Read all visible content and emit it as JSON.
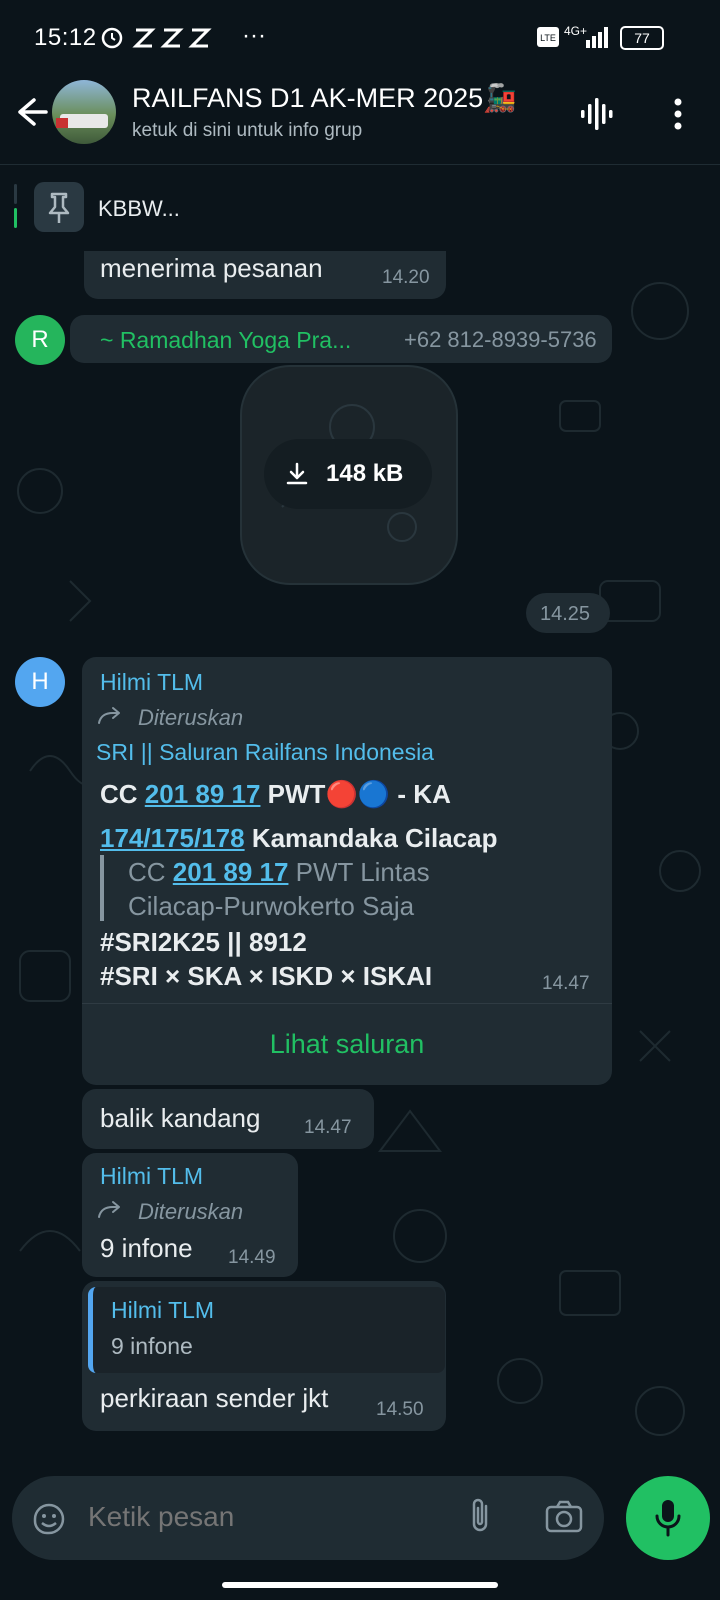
{
  "status_bar": {
    "time": "15:12",
    "network": "4G+",
    "battery": "77"
  },
  "header": {
    "title": "RAILFANS D1 AK-MER 2025🚂",
    "subtitle": "ketuk di sini untuk info grup"
  },
  "pinned": {
    "text": "KBBW..."
  },
  "messages": [
    {
      "text": "menerima pesanan",
      "time": "14.20"
    },
    {
      "avatar_letter": "R",
      "sender": "~ Ramadhan Yoga Pra...",
      "phone": "+62 812-8939-5736",
      "attachment_size": "148 kB",
      "time": "14.25"
    },
    {
      "avatar_letter": "H",
      "sender": "Hilmi TLM",
      "forwarded_label": "Diteruskan",
      "channel_name": "SRI || Saluran Railfans Indonesia",
      "line1_a": "CC ",
      "line1_link": "201 89 17",
      "line1_b": " PWT🔴🔵 - KA",
      "line2_link": "174/175/178",
      "line2_b": " Kamandaka Cilacap",
      "quote_a": "CC ",
      "quote_link": "201 89 17",
      "quote_b": " PWT Lintas",
      "quote_c": "Cilacap-Purwokerto Saja",
      "tags1": "#SRI2K25 || 8912",
      "tags2": "#SRI × SKA × ISKD × ISKAI",
      "time": "14.47",
      "action": "Lihat saluran"
    },
    {
      "text": "balik kandang",
      "time": "14.47"
    },
    {
      "sender": "Hilmi TLM",
      "forwarded_label": "Diteruskan",
      "text": "9 infone",
      "time": "14.49"
    },
    {
      "reply_sender": "Hilmi TLM",
      "reply_text": "9 infone",
      "text": "perkiraan sender jkt",
      "time": "14.50"
    }
  ],
  "input": {
    "placeholder": "Ketik pesan"
  },
  "colors": {
    "background": "#0b141a",
    "bubble": "#202c33",
    "accent_green": "#21c063",
    "link_blue": "#53bdeb"
  },
  "icons": [
    "back-arrow-icon",
    "voice-chat-icon",
    "more-vertical-icon",
    "pin-icon",
    "download-icon",
    "forward-icon",
    "sticker-icon",
    "attach-icon",
    "camera-icon",
    "mic-icon"
  ]
}
